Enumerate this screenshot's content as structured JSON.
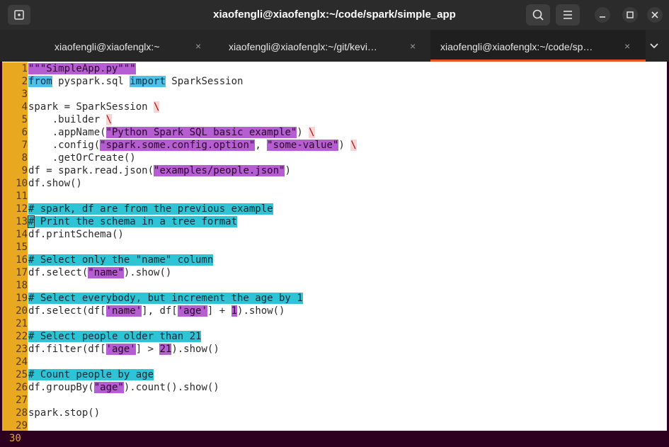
{
  "window": {
    "title": "xiaofengli@xiaofenglx:~/code/spark/simple_app"
  },
  "tabs": [
    {
      "label": "xiaofengli@xiaofenglx:~",
      "close": "×"
    },
    {
      "label": "xiaofengli@xiaofenglx:~/git/kevi…",
      "close": "×"
    },
    {
      "label": "xiaofengli@xiaofenglx:~/code/sp…",
      "close": "×"
    }
  ],
  "tabmenu_icon": "chevron-down-icon",
  "editor": {
    "lines": [
      {
        "n": "1",
        "segs": [
          [
            "\"\"\"SimpleApp.py\"\"\"",
            "str"
          ]
        ]
      },
      {
        "n": "2",
        "segs": [
          [
            "from",
            "kw"
          ],
          [
            " pyspark.sql ",
            ""
          ],
          [
            "import",
            "kw"
          ],
          [
            " SparkSession",
            ""
          ]
        ]
      },
      {
        "n": "3",
        "segs": []
      },
      {
        "n": "4",
        "segs": [
          [
            "spark = SparkSession ",
            ""
          ],
          [
            "\\",
            "bs"
          ]
        ]
      },
      {
        "n": "5",
        "segs": [
          [
            "    .builder ",
            ""
          ],
          [
            "\\",
            "bs"
          ]
        ]
      },
      {
        "n": "6",
        "segs": [
          [
            "    .appName(",
            ""
          ],
          [
            "\"Python Spark SQL basic example\"",
            "str"
          ],
          [
            ") ",
            ""
          ],
          [
            "\\",
            "bs"
          ]
        ]
      },
      {
        "n": "7",
        "segs": [
          [
            "    .config(",
            ""
          ],
          [
            "\"spark.some.config.option\"",
            "str"
          ],
          [
            ", ",
            ""
          ],
          [
            "\"some-value\"",
            "str"
          ],
          [
            ") ",
            ""
          ],
          [
            "\\",
            "bs"
          ]
        ]
      },
      {
        "n": "8",
        "segs": [
          [
            "    .getOrCreate()",
            ""
          ]
        ]
      },
      {
        "n": "9",
        "segs": [
          [
            "df = spark.read.json(",
            ""
          ],
          [
            "\"examples/people.json\"",
            "str"
          ],
          [
            ")",
            ""
          ]
        ]
      },
      {
        "n": "10",
        "segs": [
          [
            "df.show()",
            ""
          ]
        ]
      },
      {
        "n": "11",
        "segs": []
      },
      {
        "n": "12",
        "segs": [
          [
            "# spark, df are from the previous example",
            "cm"
          ]
        ]
      },
      {
        "n": "13",
        "segs": [
          [
            "#",
            "cmcur"
          ],
          [
            " Print the schema in a tree format",
            "cm"
          ]
        ]
      },
      {
        "n": "14",
        "segs": [
          [
            "df.printSchema()",
            ""
          ]
        ]
      },
      {
        "n": "15",
        "segs": []
      },
      {
        "n": "16",
        "segs": [
          [
            "# Select only the \"name\" column",
            "cm"
          ]
        ]
      },
      {
        "n": "17",
        "segs": [
          [
            "df.select(",
            ""
          ],
          [
            "\"name\"",
            "str"
          ],
          [
            ").show()",
            ""
          ]
        ]
      },
      {
        "n": "18",
        "segs": []
      },
      {
        "n": "19",
        "segs": [
          [
            "# Select everybody, but increment the age by 1",
            "cm"
          ]
        ]
      },
      {
        "n": "20",
        "segs": [
          [
            "df.select(df[",
            ""
          ],
          [
            "'name'",
            "str"
          ],
          [
            "], df[",
            ""
          ],
          [
            "'age'",
            "str"
          ],
          [
            "] + ",
            ""
          ],
          [
            "1",
            "num"
          ],
          [
            ").show()",
            ""
          ]
        ]
      },
      {
        "n": "21",
        "segs": []
      },
      {
        "n": "22",
        "segs": [
          [
            "# Select people older than 21",
            "cm"
          ]
        ]
      },
      {
        "n": "23",
        "segs": [
          [
            "df.filter(df[",
            ""
          ],
          [
            "'age'",
            "str"
          ],
          [
            "] > ",
            ""
          ],
          [
            "21",
            "num"
          ],
          [
            ").show()",
            ""
          ]
        ]
      },
      {
        "n": "24",
        "segs": []
      },
      {
        "n": "25",
        "segs": [
          [
            "# Count people by age",
            "cm"
          ]
        ]
      },
      {
        "n": "26",
        "segs": [
          [
            "df.groupBy(",
            ""
          ],
          [
            "\"age\"",
            "str"
          ],
          [
            ").count().show()",
            ""
          ]
        ]
      },
      {
        "n": "27",
        "segs": []
      },
      {
        "n": "28",
        "segs": [
          [
            "spark.stop()",
            ""
          ]
        ]
      },
      {
        "n": "29",
        "segs": []
      }
    ]
  },
  "status": {
    "line": "30"
  },
  "colors": {
    "accent": "#e95420",
    "linenr": "#e8a81f",
    "string": "#b55ed1",
    "keyword": "#4fc0e8",
    "comment": "#2ec4d6"
  }
}
